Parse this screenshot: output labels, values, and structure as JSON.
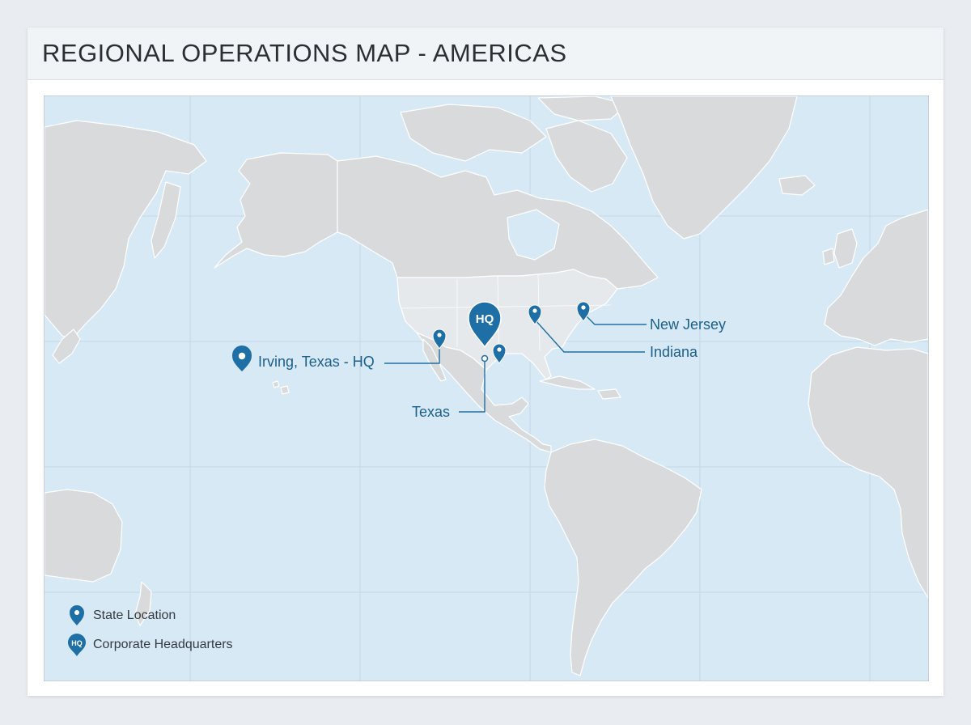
{
  "header": {
    "title": "REGIONAL OPERATIONS MAP - AMERICAS"
  },
  "map": {
    "hq_marker_text": "HQ",
    "locations": [
      {
        "id": "irving",
        "label": "Irving, Texas - HQ",
        "type": "hq"
      },
      {
        "id": "texas",
        "label": "Texas",
        "type": "state"
      },
      {
        "id": "indiana",
        "label": "Indiana",
        "type": "state"
      },
      {
        "id": "new-jersey",
        "label": "New Jersey",
        "type": "state"
      }
    ]
  },
  "legend": {
    "state_label": "State Location",
    "hq_label": "Corporate Headquarters",
    "hq_icon_text": "HQ"
  },
  "colors": {
    "ocean": "#d8e9f6",
    "land": "#d9dadc",
    "land_stroke": "#ffffff",
    "us_land": "#e6e9ec",
    "marker": "#1e6fa6",
    "label": "#1a5f8c",
    "grid": "#c5d7e6"
  },
  "icons": {
    "state": "map-pin-icon",
    "hq": "hq-pin-icon",
    "label_pin": "location-pin-icon"
  }
}
